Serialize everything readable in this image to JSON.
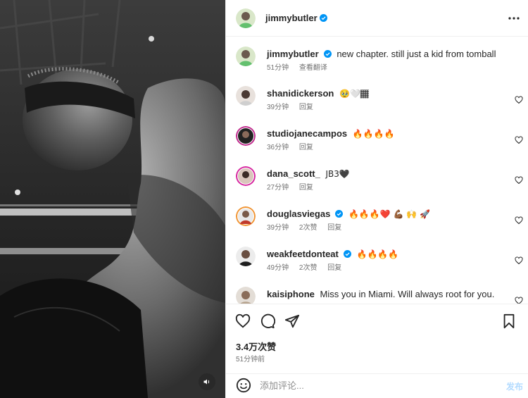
{
  "post": {
    "author": "jimmybutler",
    "caption": "new chapter. still just a kid from tomball",
    "caption_time": "51分钟",
    "see_translation": "查看翻译",
    "likes": "3.4万次赞",
    "posted_time": "51分钟前"
  },
  "comments": [
    {
      "user": "shanidickerson",
      "text": "🥹🤍🏾",
      "time": "39分钟",
      "reply": "回复",
      "likes": "",
      "verified": false
    },
    {
      "user": "studiojanecampos",
      "text": "🔥🔥🔥🔥",
      "time": "36分钟",
      "reply": "回复",
      "likes": "",
      "verified": false
    },
    {
      "user": "dana_scott_",
      "text": "JB3🖤",
      "time": "27分钟",
      "reply": "回复",
      "likes": "",
      "verified": false
    },
    {
      "user": "douglasviegas",
      "text": "🔥🔥🔥❤️ 💪🏾 🙌 🚀",
      "time": "39分钟",
      "reply": "回复",
      "likes": "2次赞",
      "verified": true
    },
    {
      "user": "weakfeetdonteat",
      "text": "🔥🔥🔥🔥",
      "time": "49分钟",
      "reply": "回复",
      "likes": "2次赞",
      "verified": true
    },
    {
      "user": "kaisiphone",
      "text": "Miss you in Miami. Will always root for you.",
      "time": "",
      "reply": "",
      "likes": "",
      "verified": false
    }
  ],
  "comment_box": {
    "placeholder": "添加评论...",
    "post_label": "发布"
  },
  "colors": {
    "verified": "#0095f6",
    "link_disabled": "#b3dbff",
    "muted_text": "#737373"
  },
  "icons": {
    "like": "heart-icon",
    "comment": "comment-icon",
    "share": "share-icon",
    "save": "bookmark-icon",
    "more": "more-icon",
    "emoji": "smile-icon",
    "audio": "speaker-icon"
  }
}
